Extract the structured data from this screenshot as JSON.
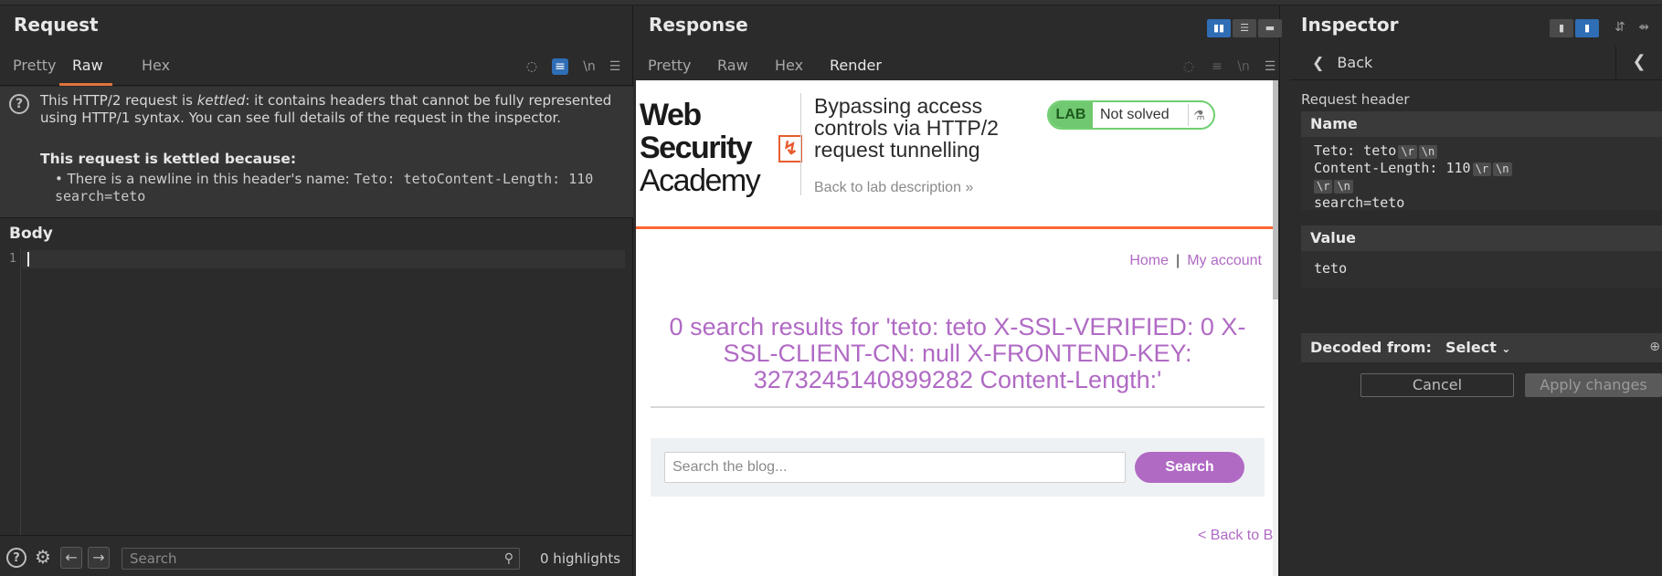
{
  "request": {
    "title": "Request",
    "tabs": [
      "Pretty",
      "Raw",
      "Hex"
    ],
    "active_tab": "Raw",
    "newline_icon_label": "\\n",
    "kettle": {
      "msg_pre": "This HTTP/2 request is ",
      "msg_em": "kettled",
      "msg_post": ": it contains headers that cannot be fully represented using HTTP/1 syntax. You can see full details of the request in the inspector.",
      "because_title": "This request is kettled because:",
      "bullet_text": "There is a newline in this header's name: ",
      "bullet_code": "Teto: tetoContent-Length: 110 search=teto"
    },
    "body_label": "Body",
    "line_number": "1",
    "footer": {
      "search_placeholder": "Search",
      "highlights": "0 highlights"
    }
  },
  "response": {
    "title": "Response",
    "tabs": [
      "Pretty",
      "Raw",
      "Hex",
      "Render"
    ],
    "active_tab": "Render",
    "newline_icon_label": "\\n",
    "render": {
      "logo_line1": "Web Security",
      "logo_line2": "Academy",
      "lab_title": "Bypassing access controls via HTTP/2 request tunnelling",
      "back_to_lab": "Back to lab description",
      "lab_badge": "LAB",
      "lab_status": "Not solved",
      "nav_home": "Home",
      "nav_sep": "|",
      "nav_account": "My account",
      "results_text": "0 search results for 'teto: teto X-SSL-VERIFIED: 0 X-SSL-CLIENT-CN: null X-FRONTEND-KEY: 3273245140899282 Content-Length:'",
      "search_placeholder": "Search the blog...",
      "search_button": "Search",
      "back_to_blog": "< Back to Blog"
    }
  },
  "inspector": {
    "title": "Inspector",
    "back_label": "Back",
    "section_label": "Request header",
    "name_header": "Name",
    "name_value_line1": "Teto: teto",
    "name_value_line2": "Content-Length: 110",
    "name_value_line4": "search=teto",
    "escape_r": "\\r",
    "escape_n": "\\n",
    "value_header": "Value",
    "value_text": "teto",
    "decoded_label": "Decoded from:",
    "decoded_select": "Select",
    "cancel_label": "Cancel",
    "apply_label": "Apply changes"
  },
  "colors": {
    "accent_tab": "#e0743c",
    "toggle_blue": "#2f6db5",
    "lab_purple": "#b06ac4",
    "lab_green": "#70c870",
    "portswigger_orange": "#ff6633"
  },
  "icons": {
    "request_toolbar": [
      "hidden-eye-icon",
      "wrap-lines-icon",
      "newline-icon",
      "menu-icon"
    ],
    "footer": [
      "help-icon",
      "settings-icon",
      "back-arrow-icon",
      "forward-arrow-icon",
      "search-icon"
    ]
  }
}
